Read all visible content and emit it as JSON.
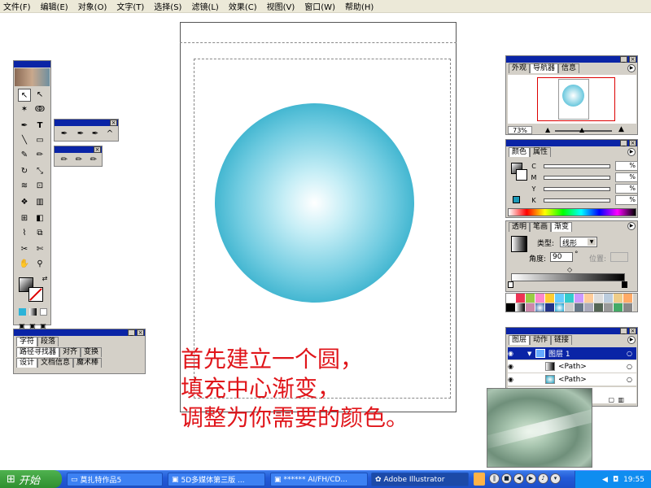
{
  "menu": [
    "文件(F)",
    "编辑(E)",
    "对象(O)",
    "文字(T)",
    "选择(S)",
    "滤镜(L)",
    "效果(C)",
    "视图(V)",
    "窗口(W)",
    "帮助(H)"
  ],
  "caption": "首先建立一个圆，\n填充中心渐变，\n调整为你需要的颜色。",
  "navigator": {
    "tabs": [
      "外观",
      "导航器",
      "信息"
    ],
    "zoom": "73%"
  },
  "color": {
    "tabs": [
      "颜色",
      "属性"
    ],
    "channels": [
      "C",
      "M",
      "Y",
      "K"
    ],
    "values": [
      "%",
      "%",
      "%",
      "%"
    ]
  },
  "gradient": {
    "tabs": [
      "透明",
      "笔画",
      "渐变"
    ],
    "type_label": "类型:",
    "type_value": "线形",
    "angle_label": "角度:",
    "angle_value": "90",
    "degree": "°",
    "location_label": "位置:"
  },
  "layers": {
    "tabs": [
      "图层",
      "动作",
      "链接"
    ],
    "rows": [
      "图层 1",
      "<Path>",
      "<Path>"
    ]
  },
  "type_panel": {
    "tabs1": [
      "字符",
      "段落"
    ],
    "tabs2": [
      "路径寻找器",
      "对齐",
      "变换"
    ],
    "tabs3": [
      "设计",
      "文档信息",
      "魔术棒"
    ]
  },
  "taskbar": {
    "start": "开始",
    "tasks": [
      "莫扎特作品5",
      "5D多媒体第三版 ...",
      "****** AI/FH/CD...",
      "Adobe Illustrator"
    ],
    "time": "19:55"
  },
  "colors": {
    "accent": "#0a24a6",
    "caption": "#e0151a",
    "circle_edge": "#1b9ab9"
  }
}
